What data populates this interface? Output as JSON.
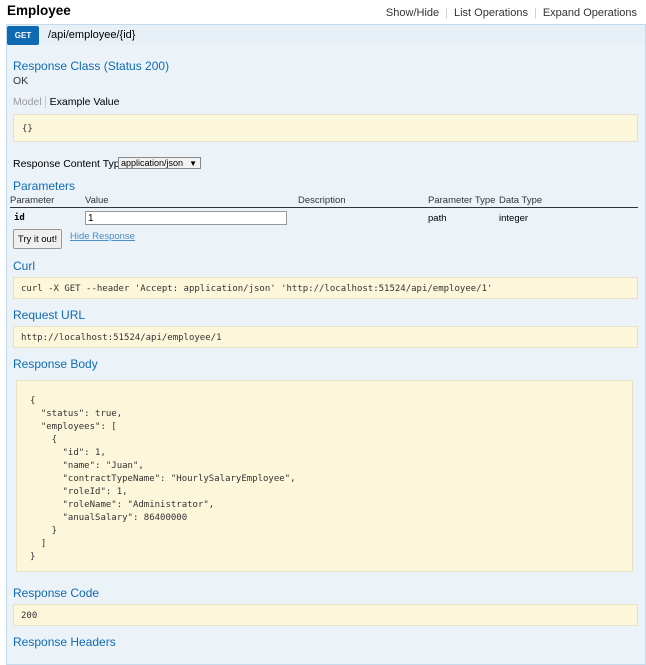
{
  "resource": {
    "title": "Employee",
    "links": [
      "Show/Hide",
      "List Operations",
      "Expand Operations"
    ]
  },
  "operation": {
    "method": "GET",
    "path": "/api/employee/{id}"
  },
  "response_class": {
    "title": "Response Class (Status 200)",
    "status_text": "OK",
    "tab_model": "Model",
    "tab_example": "Example Value",
    "example_value": "{}"
  },
  "content_type": {
    "label": "Response Content Type",
    "selected": "application/json"
  },
  "parameters": {
    "title": "Parameters",
    "headers": [
      "Parameter",
      "Value",
      "Description",
      "Parameter Type",
      "Data Type"
    ],
    "rows": [
      {
        "parameter": "id",
        "value": "1",
        "description": "",
        "parameter_type": "path",
        "data_type": "integer"
      }
    ]
  },
  "actions": {
    "try_label": "Try it out!",
    "hide_label": "Hide Response"
  },
  "curl": {
    "title": "Curl",
    "command": "curl -X GET --header 'Accept: application/json' 'http://localhost:51524/api/employee/1'"
  },
  "request_url": {
    "title": "Request URL",
    "url": "http://localhost:51524/api/employee/1"
  },
  "response_body": {
    "title": "Response Body",
    "lines": [
      "{",
      "  \"status\": true,",
      "  \"employees\": [",
      "    {",
      "      \"id\": 1,",
      "      \"name\": \"Juan\",",
      "      \"contractTypeName\": \"HourlySalaryEmployee\",",
      "      \"roleId\": 1,",
      "      \"roleName\": \"Administrator\",",
      "      \"anualSalary\": 86400000",
      "    }",
      "  ]",
      "}"
    ]
  },
  "response_code": {
    "title": "Response Code",
    "code": "200"
  },
  "response_headers": {
    "title": "Response Headers"
  },
  "colors": {
    "get_method": "#0f6ab4",
    "section_title": "#0f6ab4",
    "op_background": "#ebf3f9",
    "code_background": "#fcf6db"
  }
}
